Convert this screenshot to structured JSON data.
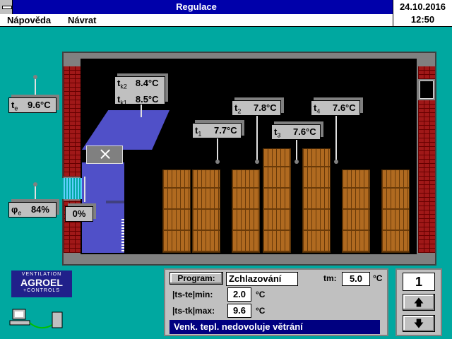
{
  "window": {
    "title": "Regulace"
  },
  "clock": {
    "date": "24.10.2016",
    "time": "12:50"
  },
  "menu": {
    "help": "Nápověda",
    "back": "Návrat"
  },
  "sensors": {
    "te": {
      "label": "t",
      "sub": "e",
      "value": "9.6°C"
    },
    "phie": {
      "label": "φ",
      "sub": "e",
      "value": "84%"
    },
    "tk2": {
      "label": "t",
      "sub": "k2",
      "value": "8.4°C"
    },
    "tk1": {
      "label": "t",
      "sub": "k1",
      "value": "8.5°C"
    },
    "t1": {
      "label": "t",
      "sub": "1",
      "value": "7.7°C"
    },
    "t2": {
      "label": "t",
      "sub": "2",
      "value": "7.8°C"
    },
    "t3": {
      "label": "t",
      "sub": "3",
      "value": "7.6°C"
    },
    "t4": {
      "label": "t",
      "sub": "4",
      "value": "7.6°C"
    }
  },
  "fan_output": "0%",
  "logo": {
    "top": "VENTILATION",
    "brand": "AGROEL",
    "bottom": "+CONTROLS"
  },
  "control": {
    "program_button": "Program:",
    "program_value": "Zchlazování",
    "tm_label": "tm:",
    "tm_value": "5.0",
    "tm_unit": "°C",
    "ts_te_min_label": "|ts-te|min:",
    "ts_te_min_value": "2.0",
    "ts_te_min_unit": "°C",
    "ts_tk_max_label": "|ts-tk|max:",
    "ts_tk_max_value": "9.6",
    "ts_tk_max_unit": "°C",
    "status": "Venk. tepl. nedovoluje větrání"
  },
  "side": {
    "number": "1",
    "up_icon": "arrow-up-icon",
    "down_icon": "arrow-down-icon"
  }
}
